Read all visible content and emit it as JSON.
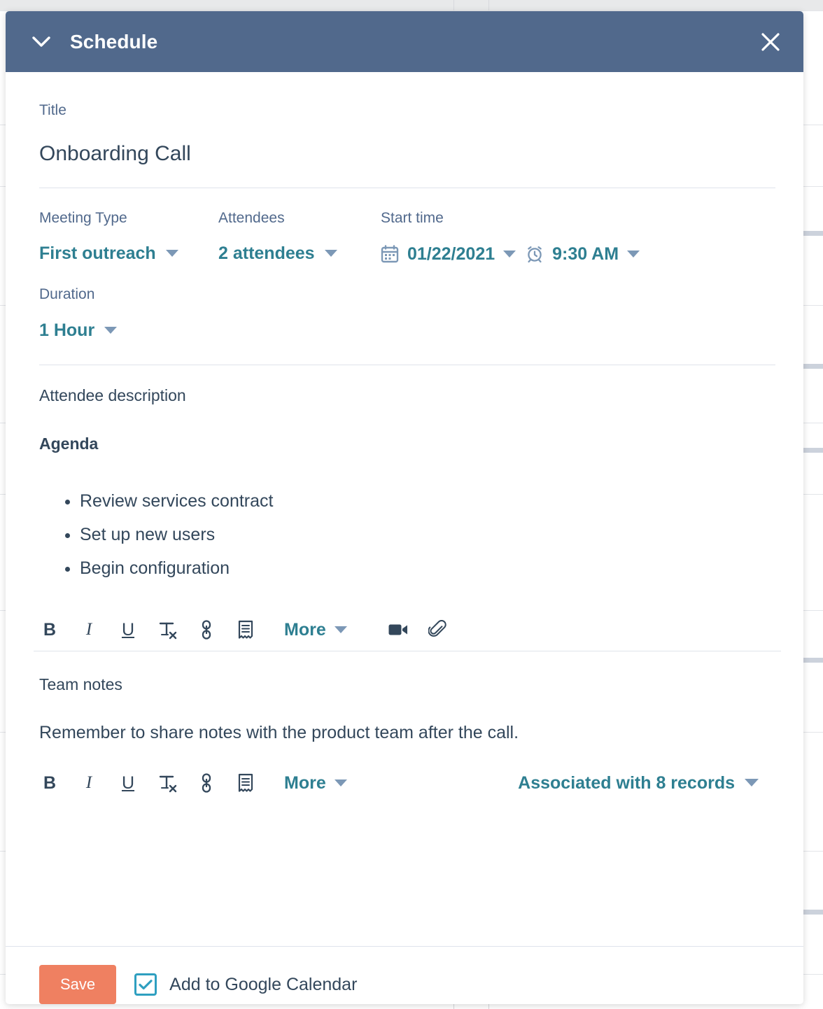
{
  "header": {
    "title": "Schedule",
    "collapse_icon": "chevron-down-icon",
    "close_icon": "close-icon",
    "background_color": "#51698c"
  },
  "title_field": {
    "label": "Title",
    "value": "Onboarding Call"
  },
  "meta": {
    "meeting_type": {
      "label": "Meeting Type",
      "value": "First outreach",
      "caret_icon": "chevron-down-icon"
    },
    "attendees": {
      "label": "Attendees",
      "value": "2 attendees",
      "caret_icon": "chevron-down-icon"
    },
    "start_time": {
      "label": "Start time",
      "date_value": "01/22/2021",
      "date_icon": "calendar-icon",
      "time_value": "9:30 AM",
      "time_icon": "alarm-clock-icon",
      "caret_icon": "chevron-down-icon"
    },
    "duration": {
      "label": "Duration",
      "value": "1 Hour",
      "caret_icon": "chevron-down-icon"
    }
  },
  "description": {
    "label": "Attendee description",
    "agenda_heading": "Agenda",
    "agenda_items": [
      "Review services contract",
      "Set up new users",
      "Begin configuration"
    ]
  },
  "description_toolbar": {
    "bold": "B",
    "italic": "I",
    "underline": "U",
    "clear_format": "Tx",
    "link": "link-icon",
    "snippet": "snippet-icon",
    "more_label": "More",
    "more_caret": "chevron-down-icon",
    "video": "video-camera-icon",
    "attach": "paperclip-icon"
  },
  "notes": {
    "label": "Team notes",
    "value": "Remember to share notes with the product team after the call."
  },
  "notes_toolbar": {
    "bold": "B",
    "italic": "I",
    "underline": "U",
    "clear_format": "Tx",
    "link": "link-icon",
    "snippet": "snippet-icon",
    "more_label": "More",
    "more_caret": "chevron-down-icon",
    "associated_label": "Associated with 8 records",
    "associated_caret": "chevron-down-icon"
  },
  "footer": {
    "save_label": "Save",
    "gcal_label": "Add to Google Calendar",
    "gcal_checked": true,
    "save_color": "#ef8061",
    "checkbox_color": "#2e9fc0"
  },
  "colors": {
    "header_bg": "#51698c",
    "teal_link": "#2e7f91",
    "slate_text": "#33475b",
    "muted_label": "#51698c",
    "divider": "#dfe3eb"
  }
}
